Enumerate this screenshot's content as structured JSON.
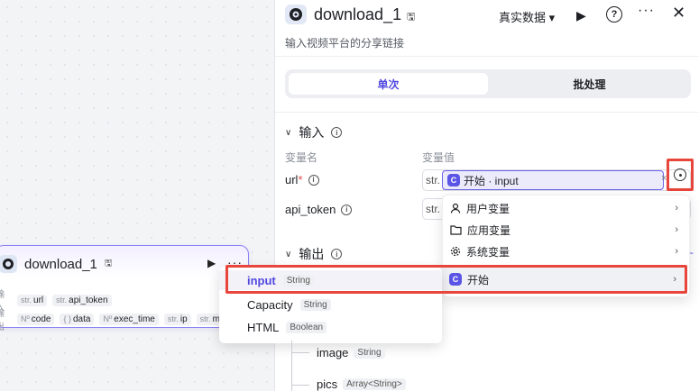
{
  "node": {
    "title": "download_1",
    "inputs_label": "输入",
    "outputs_label": "输出",
    "inputs": [
      {
        "type": "str.",
        "name": "url"
      },
      {
        "type": "str.",
        "name": "api_token"
      }
    ],
    "outputs": [
      {
        "type": "Nº",
        "name": "code"
      },
      {
        "type": "{ }",
        "name": "data"
      },
      {
        "type": "Nº",
        "name": "exec_time"
      },
      {
        "type": "str.",
        "name": "ip"
      },
      {
        "type": "str.",
        "name": "m"
      }
    ]
  },
  "panel": {
    "title": "download_1",
    "data_mode": "真实数据 ▾",
    "description": "输入视频平台的分享链接",
    "tabs": [
      {
        "label": "单次",
        "active": true
      },
      {
        "label": "批处理",
        "active": false
      }
    ],
    "input_section": "输入",
    "col_name": "变量名",
    "col_value": "变量值",
    "vars": [
      {
        "name": "url",
        "required": "*",
        "type": "str.",
        "ref_label": "开始 · input"
      },
      {
        "name": "api_token",
        "type": "str."
      }
    ],
    "output_section": "输出",
    "accent": "#5148e0",
    "highlight": "#e8453c"
  },
  "menu": {
    "items": [
      {
        "icon": "user-icon",
        "label": "用户变量"
      },
      {
        "icon": "folder-icon",
        "label": "应用变量"
      },
      {
        "icon": "gear-icon",
        "label": "系统变量"
      }
    ],
    "start": {
      "label": "开始"
    }
  },
  "submenu": [
    {
      "name": "input",
      "type": "String",
      "selected": true
    },
    {
      "name": "Capacity",
      "type": "String",
      "selected": false
    },
    {
      "name": "HTML",
      "type": "Boolean",
      "selected": false
    }
  ],
  "outputs_tree": [
    {
      "name": "image",
      "type": "String"
    },
    {
      "name": "pics",
      "type": "Array<String>"
    }
  ]
}
